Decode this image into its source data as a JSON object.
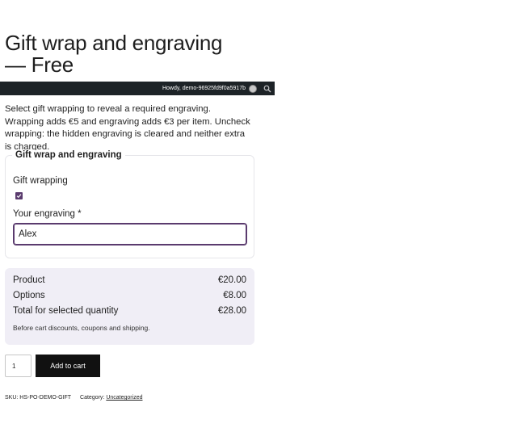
{
  "product": {
    "title": "Gift wrap and engraving — Free",
    "description": "Select gift wrapping to reveal a required engraving. Wrapping adds €5 and engraving adds €3 per item. Uncheck wrapping: the hidden engraving is cleared and neither extra is charged."
  },
  "admin_bar": {
    "howdy": "Howdy, demo-96925fd9f0a5917b",
    "avatar_icon": "avatar-icon",
    "search_icon": "search-icon",
    "background": "#1d2327"
  },
  "options": {
    "legend": "Gift wrap and engraving",
    "wrapping_label": "Gift wrapping",
    "wrapping_checked": true,
    "engraving_label": "Your engraving *",
    "engraving_value": "Alex",
    "accent_color": "#5a3b6e"
  },
  "totals": {
    "rows": [
      {
        "label": "Product",
        "value": "€20.00"
      },
      {
        "label": "Options",
        "value": "€8.00"
      },
      {
        "label": "Total for selected quantity",
        "value": "€28.00"
      }
    ],
    "note": "Before cart discounts, coupons and shipping.",
    "background": "#f0eef6"
  },
  "cart": {
    "quantity": "1",
    "add_button": "Add to cart"
  },
  "meta": {
    "sku_label": "SKU:",
    "sku": "HS-PO-DEMO-GIFT",
    "category_label": "Category:",
    "category": "Uncategorized"
  }
}
